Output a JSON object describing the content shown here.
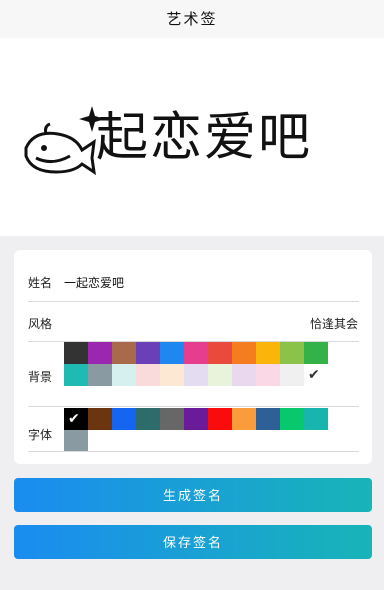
{
  "header": {
    "title": "艺术签"
  },
  "preview": {
    "signature_text": "起恋爱吧"
  },
  "form": {
    "name_label": "姓名",
    "name_value": "一起恋爱吧",
    "style_label": "风格",
    "style_value": "恰逢其会",
    "background_label": "背景",
    "font_label": "字体"
  },
  "background_colors": [
    "#333333",
    "#9b27b0",
    "#a86a4b",
    "#6a3fb8",
    "#1e88f0",
    "#e63d8e",
    "#e94a3c",
    "#f57c1f",
    "#fbb50a",
    "#8bc34a",
    "#33b249",
    "#1fbab1",
    "#8a9aa3",
    "#d6f0ee",
    "#fadbdb",
    "#fde8d4",
    "#e4dcf0",
    "#e8f3dc",
    "#ead8ee",
    "#fad8e6",
    "#f0f0f0",
    "#ffffff"
  ],
  "background_selected_index": 21,
  "font_colors": [
    "#000000",
    "#6b3510",
    "#1565f0",
    "#2e6b6b",
    "#676767",
    "#6a1b9a",
    "#fa0c0c",
    "#fb9c3c",
    "#2e5f96",
    "#08c86d",
    "#17b5ad",
    "#8a9aa3"
  ],
  "font_selected_index": 0,
  "buttons": {
    "generate": "生成签名",
    "save": "保存签名"
  }
}
